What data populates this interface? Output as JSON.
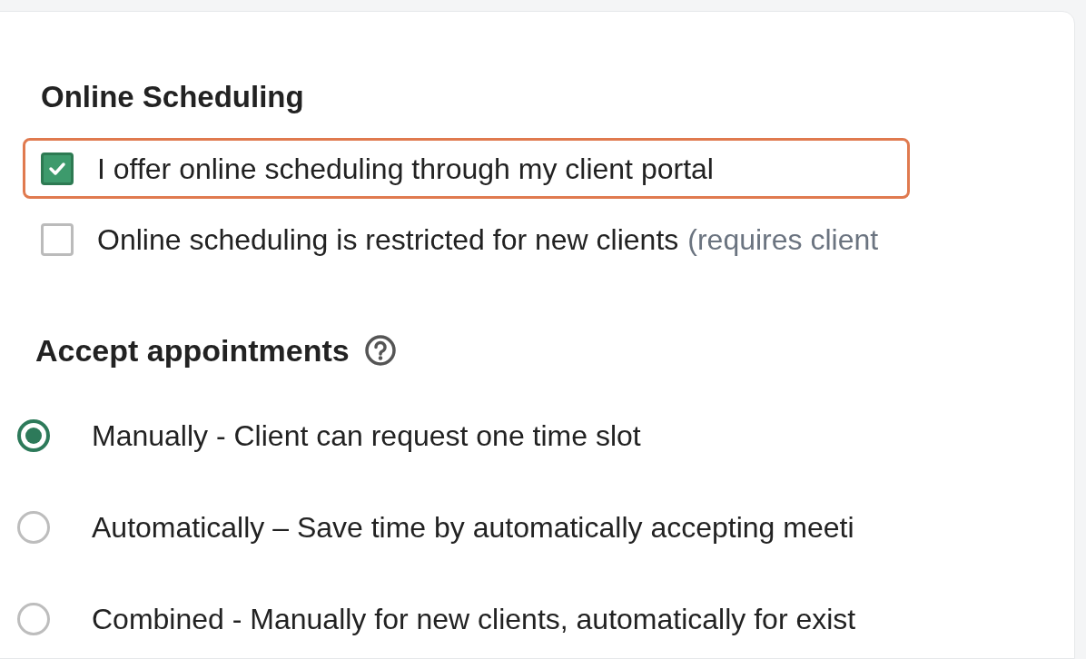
{
  "section_title": "Online Scheduling",
  "options": [
    {
      "label": "I offer online scheduling through my client portal",
      "checked": true,
      "highlighted": true
    },
    {
      "label": "Online scheduling is restricted for new clients",
      "note": "(requires client",
      "checked": false,
      "highlighted": false
    }
  ],
  "accept": {
    "title": "Accept appointments",
    "choices": [
      {
        "label": "Manually - Client can request one time slot",
        "selected": true
      },
      {
        "label": "Automatically – Save time by automatically accepting meeti",
        "selected": false
      },
      {
        "label": "Combined - Manually for new clients, automatically for exist",
        "selected": false
      }
    ]
  }
}
